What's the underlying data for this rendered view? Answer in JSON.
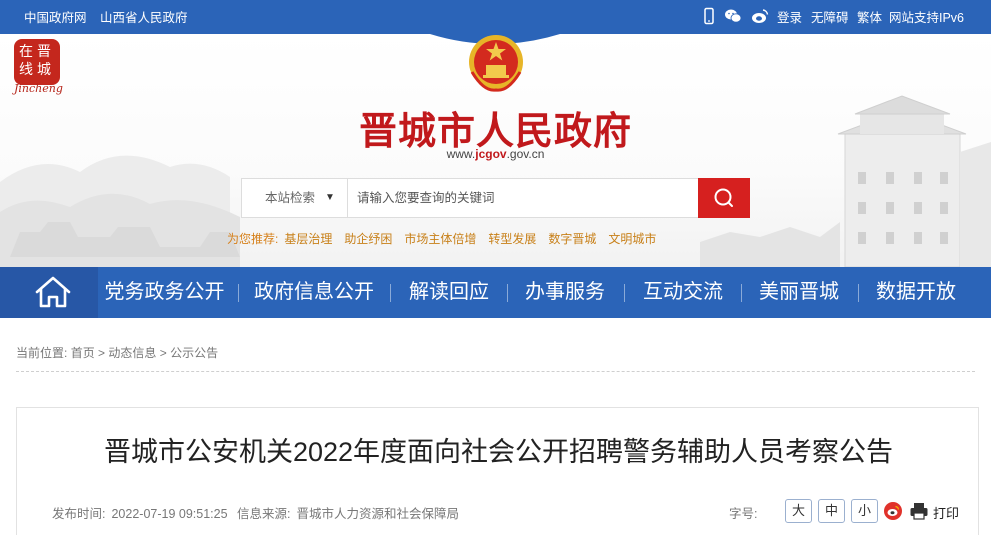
{
  "topbar": {
    "left_links": [
      "中国政府网",
      "山西省人民政府"
    ],
    "right_links": [
      "登录",
      "无障碍",
      "繁体",
      "网站支持IPv6"
    ],
    "icons": [
      "mobile-icon",
      "wechat-icon",
      "weibo-icon"
    ]
  },
  "header": {
    "logo_lines": [
      "在晋",
      "线城"
    ],
    "logo_en": "Jincheng",
    "title": "晋城市人民政府",
    "url_prefix": "www.",
    "url_brand": "jcgov",
    "url_suffix": ".gov.cn"
  },
  "search": {
    "category": "本站检索",
    "placeholder": "请输入您要查询的关键词"
  },
  "recommend": {
    "label": "为您推荐:",
    "items": [
      "基层治理",
      "助企纾困",
      "市场主体倍增",
      "转型发展",
      "数字晋城",
      "文明城市"
    ]
  },
  "nav": {
    "items": [
      "党务政务公开",
      "政府信息公开",
      "解读回应",
      "办事服务",
      "互动交流",
      "美丽晋城",
      "数据开放"
    ]
  },
  "breadcrumb": {
    "label": "当前位置:",
    "items": [
      "首页",
      "动态信息",
      "公示公告"
    ],
    "separator": ">"
  },
  "article": {
    "title": "晋城市公安机关2022年度面向社会公开招聘警务辅助人员考察公告",
    "publish_label": "发布时间:",
    "publish_time": "2022-07-19 09:51:25",
    "source_label": "信息来源:",
    "source": "晋城市人力资源和社会保障局",
    "font_label": "字号:",
    "font_sizes": [
      "大",
      "中",
      "小"
    ],
    "print_label": "打印"
  },
  "colors": {
    "brand_blue": "#2b64b8",
    "title_red": "#c1191c",
    "search_red": "#d6201f",
    "recommend_orange": "#c88019"
  }
}
